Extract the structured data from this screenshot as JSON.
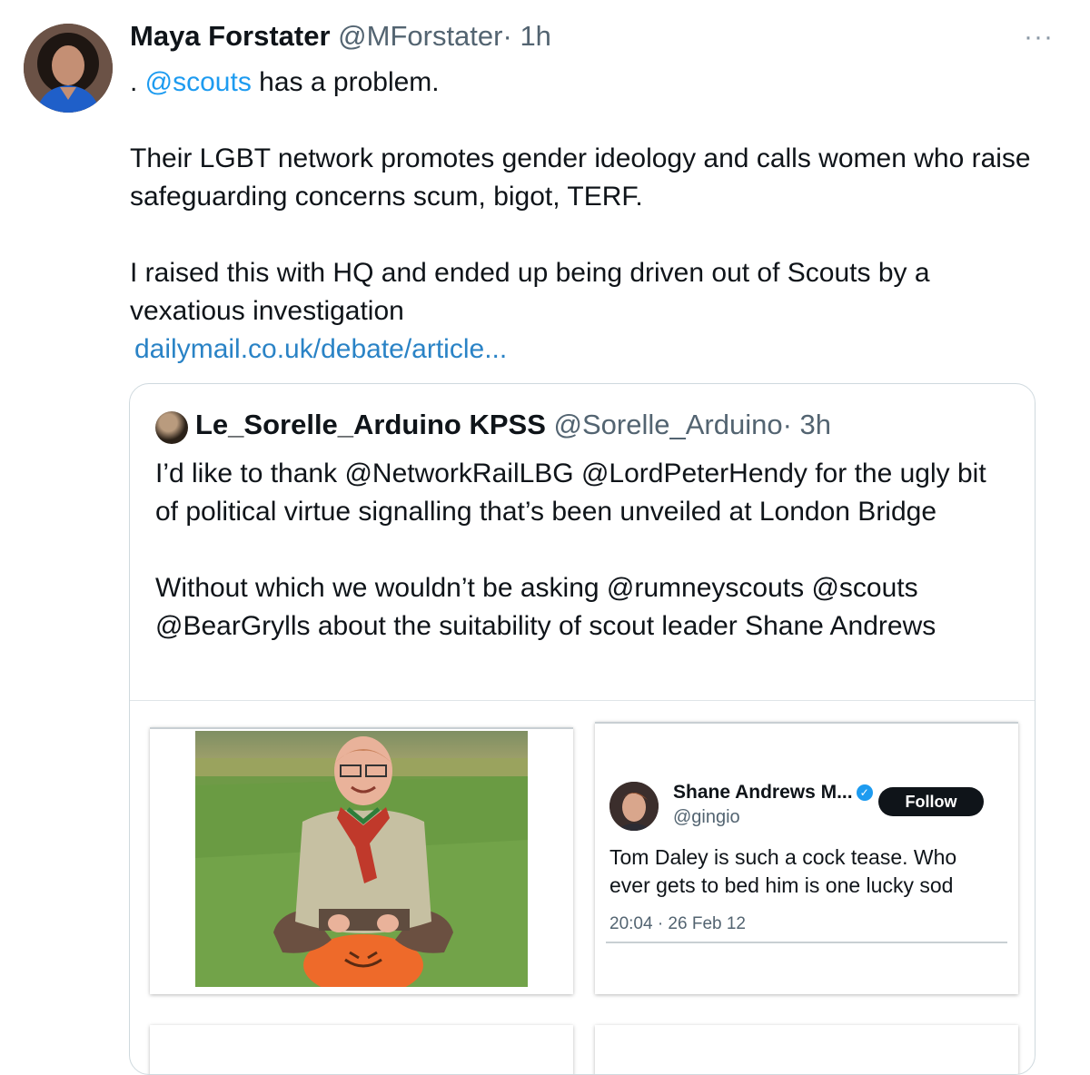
{
  "tweet": {
    "author_name": "Maya Forstater",
    "author_handle": "@MForstater",
    "separator": "·",
    "time": "1h",
    "more_label": "···",
    "text_prefix": ". ",
    "mention": "@scouts",
    "text_suffix": " has a problem.",
    "paragraph_2": "Their LGBT network promotes  gender ideology and calls women who raise safeguarding concerns scum, bigot, TERF.",
    "paragraph_3": "I raised this with HQ and ended up being driven out of Scouts by a vexatious investigation",
    "link": "dailymail.co.uk/debate/article..."
  },
  "quote": {
    "author_name": "Le_Sorelle_Arduino KPSS",
    "author_handle": "@Sorelle_Arduino",
    "separator": "·",
    "time": "3h",
    "paragraph_1": "I’d like to thank @NetworkRailLBG @LordPeterHendy for the ugly bit of political virtue signalling that’s been unveiled at London Bridge",
    "paragraph_2": "Without which we wouldn’t be asking @rumneyscouts @scouts @BearGrylls about the suitability of scout leader Shane Andrews"
  },
  "embedded_tweet": {
    "name": "Shane Andrews M...",
    "verified_icon": "verified-badge-icon",
    "handle": "@gingio",
    "follow_label": "Follow",
    "text": "Tom Daley is such a cock tease. Who ever gets to bed him is one lucky sod",
    "timestamp": "20:04 · 26 Feb 12"
  },
  "colors": {
    "link": "#1d9bf0",
    "muted": "#536471",
    "border": "#cfd9de"
  }
}
